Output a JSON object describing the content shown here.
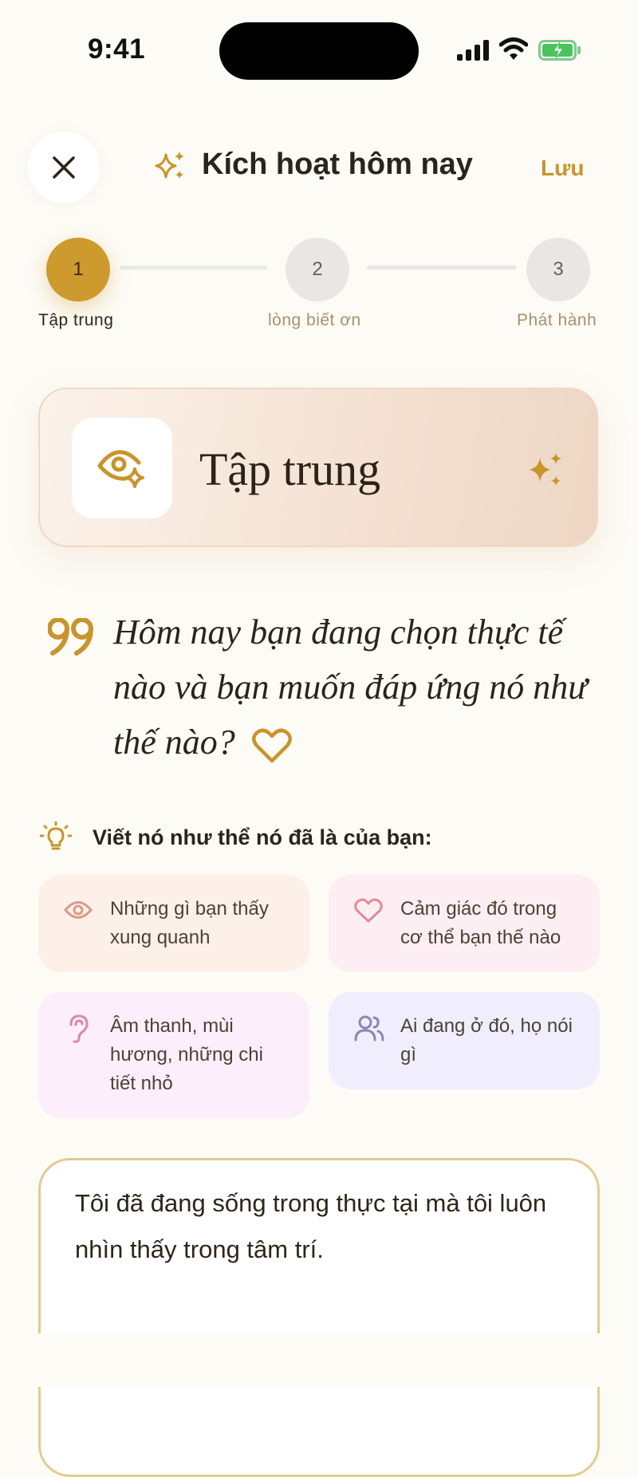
{
  "status_bar": {
    "time": "9:41"
  },
  "header": {
    "title": "Kích hoạt hôm nay",
    "save_label": "Lưu"
  },
  "steps": [
    {
      "number": "1",
      "label": "Tập trung"
    },
    {
      "number": "2",
      "label": "lòng biết ơn"
    },
    {
      "number": "3",
      "label": "Phát hành"
    }
  ],
  "focus_card": {
    "title": "Tập trung"
  },
  "prompt": {
    "question": "Hôm nay bạn đang chọn thực tế nào và bạn muốn đáp ứng nó như thế nào?"
  },
  "tip": {
    "label": "Viết nó như thể nó đã là của bạn:"
  },
  "chips": [
    {
      "text": "Những gì bạn thấy xung quanh",
      "icon": "eye-icon"
    },
    {
      "text": "Cảm giác đó trong cơ thể bạn thế nào",
      "icon": "heart-icon"
    },
    {
      "text": "Âm thanh, mùi hương, những chi tiết nhỏ",
      "icon": "ear-icon"
    },
    {
      "text": "Ai đang ở đó, họ nói gì",
      "icon": "people-icon"
    }
  ],
  "entry": {
    "text": "Tôi đã đang sống trong thực tại mà tôi luôn nhìn thấy trong tâm trí."
  },
  "colors": {
    "accent": "#C8952C",
    "background": "#FDFBF6"
  }
}
